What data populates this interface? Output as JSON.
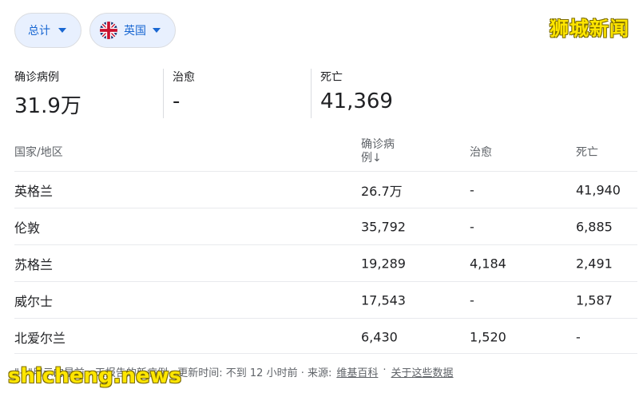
{
  "filters": {
    "scope_label": "总计",
    "region_label": "英国"
  },
  "watermark": {
    "top": "狮城新闻",
    "bottom": "shicheng.news"
  },
  "stats": [
    {
      "label": "确诊病例",
      "value": "31.9万"
    },
    {
      "label": "治愈",
      "value": "-"
    },
    {
      "label": "死亡",
      "value": "41,369"
    }
  ],
  "table": {
    "headers": [
      "国家/地区",
      "确诊病\n例↓",
      "治愈",
      "死亡"
    ],
    "rows": [
      [
        "英格兰",
        "26.7万",
        "-",
        "41,940"
      ],
      [
        "伦敦",
        "35,792",
        "-",
        "6,885"
      ],
      [
        "苏格兰",
        "19,289",
        "4,184",
        "2,491"
      ],
      [
        "威尔士",
        "17,543",
        "-",
        "1,587"
      ],
      [
        "北爱尔兰",
        "6,430",
        "1,520",
        "-"
      ]
    ]
  },
  "footer": {
    "note": "\"+\"用示的是前一天报告的新病例 · 更新时间: 不到 12 小时前 · 来源:",
    "source_link": "维基百科",
    "sep": "·",
    "about_link": "关于这些数据"
  },
  "colors": {
    "chip_bg": "#e8f0fe",
    "chip_text": "#1967d2",
    "watermark": "#ffe600"
  }
}
